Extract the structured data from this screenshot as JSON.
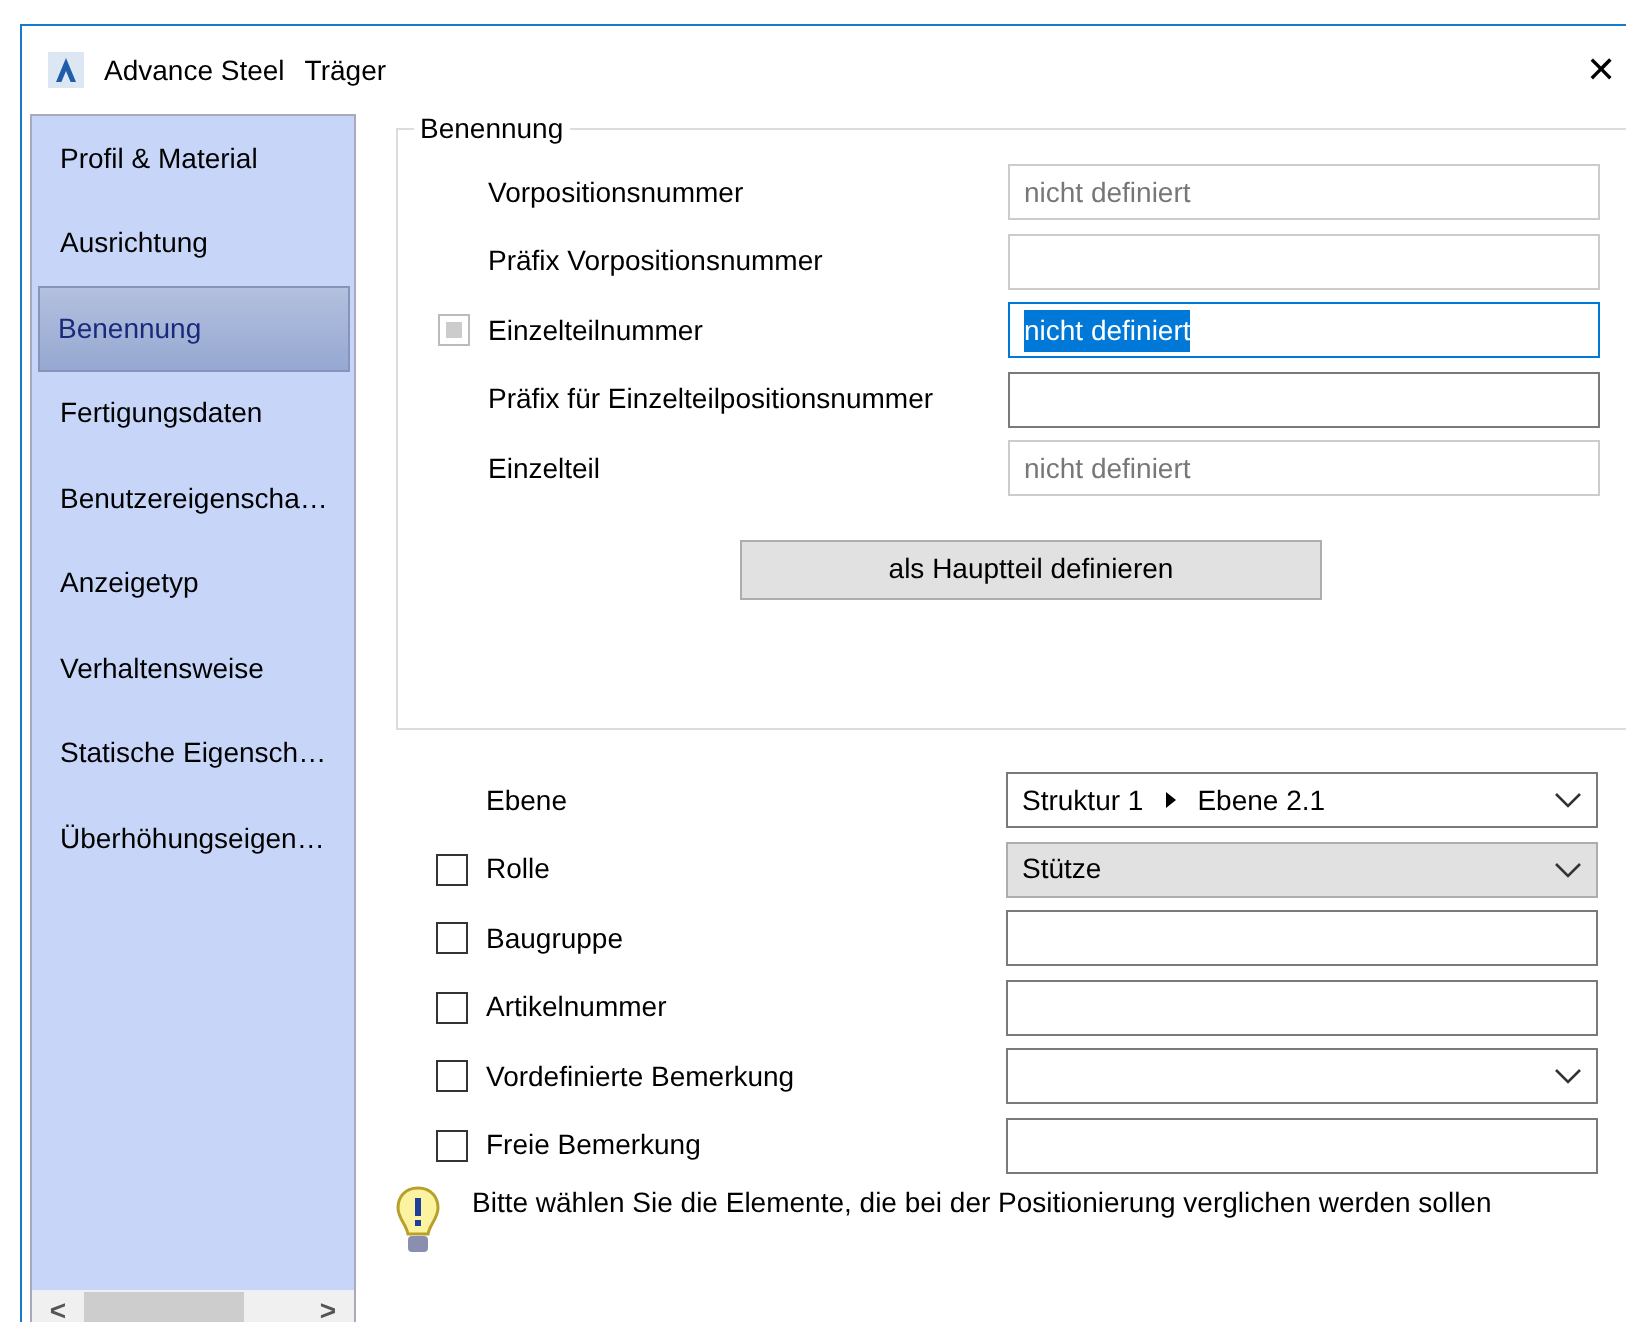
{
  "window": {
    "app": "Advance Steel",
    "title": "Träger",
    "close": "✕"
  },
  "sidebar": {
    "items": [
      {
        "label": "Profil & Material",
        "selected": false
      },
      {
        "label": "Ausrichtung",
        "selected": false
      },
      {
        "label": "Benennung",
        "selected": true
      },
      {
        "label": "Fertigungsdaten",
        "selected": false
      },
      {
        "label": "Benutzereigenscha…",
        "selected": false
      },
      {
        "label": "Anzeigetyp",
        "selected": false
      },
      {
        "label": "Verhaltensweise",
        "selected": false
      },
      {
        "label": "Statische Eigensch…",
        "selected": false
      },
      {
        "label": "Überhöhungseigen…",
        "selected": false
      }
    ],
    "scroll_left": "<",
    "scroll_right": ">"
  },
  "group": {
    "title": "Benennung",
    "rows": [
      {
        "label": "Vorpositionsnummer",
        "kind": "readonly",
        "value": "nicht definiert"
      },
      {
        "label": "Präfix Vorpositionsnummer",
        "kind": "readonly"
      },
      {
        "label": "Einzelteilnummer",
        "kind": "focused",
        "value": "nicht definiert",
        "checked": false,
        "disabled": true
      },
      {
        "label": "Präfix für Einzelteilpositionsnummer",
        "kind": "text"
      },
      {
        "label": "Einzelteil",
        "kind": "readonly",
        "value": "nicht definiert"
      }
    ],
    "button": "als Hauptteil definieren"
  },
  "rows": [
    {
      "label": "Ebene",
      "kind": "path",
      "path": [
        "Struktur 1",
        "Ebene 2.1"
      ]
    },
    {
      "label": "Rolle",
      "kind": "dropdown",
      "value": "Stütze",
      "disabled": true,
      "checked": false
    },
    {
      "label": "Baugruppe",
      "kind": "text",
      "checked": false
    },
    {
      "label": "Artikelnummer",
      "kind": "text",
      "checked": false
    },
    {
      "label": "Vordefinierte Bemerkung",
      "kind": "dropdown",
      "checked": false
    },
    {
      "label": "Freie Bemerkung",
      "kind": "text",
      "checked": false
    }
  ],
  "hint": "Bitte wählen Sie die Elemente, die bei der Positionierung verglichen werden sollen"
}
